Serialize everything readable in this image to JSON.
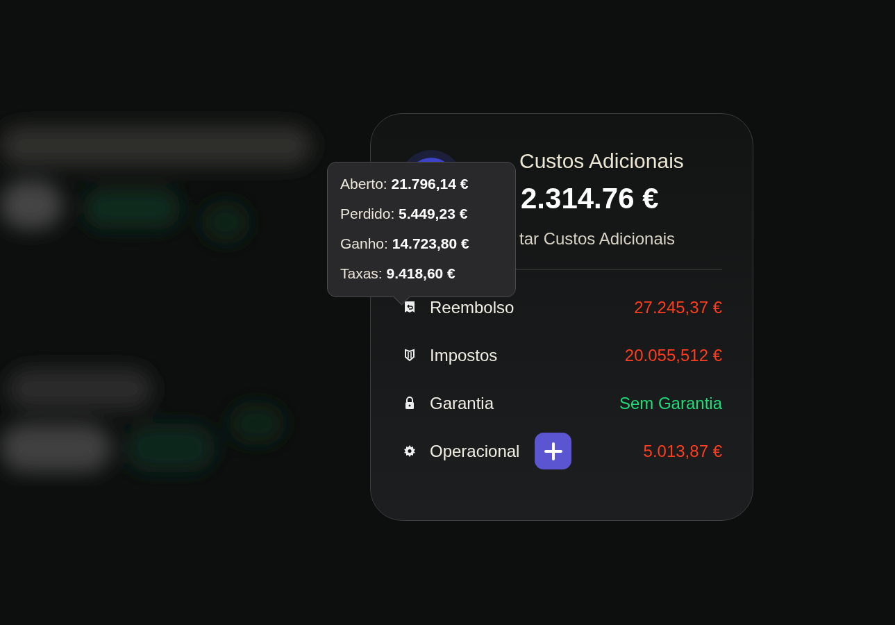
{
  "card": {
    "title": "Custos Adicionais",
    "total": "2.314.76 €",
    "link": "tar Custos Adicionais",
    "rows": [
      {
        "kind": "refund",
        "label": "Reembolso",
        "value": "27.245,37 €",
        "color": "#ff3d1f",
        "has_add_button": false
      },
      {
        "kind": "taxes",
        "label": "Impostos",
        "value": "20.055,512 €",
        "color": "#ff3d1f",
        "has_add_button": false
      },
      {
        "kind": "guarantee",
        "label": "Garantia",
        "value": "Sem Garantia",
        "color": "#1fdc7a",
        "has_add_button": false
      },
      {
        "kind": "operational",
        "label": "Operacional",
        "value": "5.013,87 €",
        "color": "#ff3d1f",
        "has_add_button": true
      }
    ]
  },
  "tooltip": {
    "lines": [
      "Aberto: **21.796,14 €**",
      "Perdido: **5.449,23 €**",
      "Ganho: **14.723,80 €**",
      "Taxas: **9.418,60 €**"
    ]
  }
}
